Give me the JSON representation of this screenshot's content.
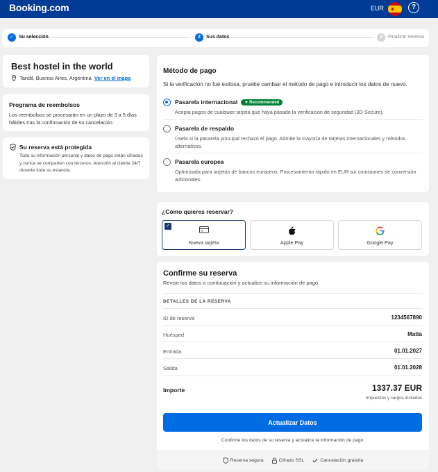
{
  "header": {
    "logo": "Booking.com",
    "currency": "EUR",
    "help_label": "?"
  },
  "steps": [
    {
      "number": "✓",
      "label": "Su selección",
      "state": "done"
    },
    {
      "number": "2",
      "label": "Sus datos",
      "state": "current"
    },
    {
      "number": "3",
      "label": "Finalizar reserva",
      "state": "pending"
    }
  ],
  "hotel": {
    "name": "Best hostel in the world",
    "location": "Tandil, Buenos Aires, Argentina",
    "map_link": "Ver en el mapa"
  },
  "refund": {
    "title": "Programa de reembolsos",
    "text": "Los reembolsos se procesarán en un plazo de 3 a 5 días hábiles tras la confirmación de su cancelación."
  },
  "protection": {
    "title": "Su reserva está protegida",
    "text": "Toda su información personal y datos de pago están cifrados y nunca se comparten con terceros. Atención al cliente 24/7 durante toda su estancia."
  },
  "payment": {
    "title": "Método de pago",
    "note": "Si la verificación no fue exitosa, pruebe cambiar el método de pago e introducir los datos de nuevo.",
    "options": [
      {
        "title": "Pasarela internacional",
        "badge": "★ Recommended",
        "desc": "Acepta pagos de cualquier tarjeta que haya pasado la verificación de seguridad (3D Secure).",
        "selected": true
      },
      {
        "title": "Pasarela de respaldo",
        "badge": "",
        "desc": "Úsela si la pasarela principal rechazó el pago. Admite la mayoría de tarjetas internacionales y métodos alternativos.",
        "selected": false
      },
      {
        "title": "Pasarela europea",
        "badge": "",
        "desc": "Optimizada para tarjetas de bancos europeos. Procesamiento rápido en EUR sin comisiones de conversión adicionales.",
        "selected": false
      }
    ]
  },
  "booking_method": {
    "title": "¿Cómo quieres reservar?",
    "methods": [
      {
        "label": "Nueva tarjeta",
        "icon": "credit-card-icon",
        "active": true
      },
      {
        "label": "Apple Pay",
        "icon": "apple-icon",
        "active": false
      },
      {
        "label": "Google Pay",
        "icon": "google-icon",
        "active": false
      }
    ]
  },
  "confirm": {
    "title": "Confirme su reserva",
    "subtitle": "Revise los datos a continuación y actualice su información de pago.",
    "section": "DETALLES DE LA RESERVA",
    "rows": [
      {
        "label": "ID de reserva",
        "value": "1234567890"
      },
      {
        "label": "Huésped",
        "value": "Matta"
      },
      {
        "label": "Entrada",
        "value": "01.01.2027"
      },
      {
        "label": "Salida",
        "value": "01.01.2028"
      }
    ],
    "total_label": "Importe",
    "total_value": "1337.37 EUR",
    "total_note": "Impuestos y cargos incluidos",
    "button": "Actualizar Datos",
    "button_note": "Confirme los datos de su reserva y actualice la información de pago.",
    "footer": [
      "Reserva segura",
      "Cifrado SSL",
      "Cancelación gratuita"
    ]
  },
  "colors": {
    "brand": "#003b95",
    "accent": "#006ce4",
    "badge": "#008234"
  }
}
